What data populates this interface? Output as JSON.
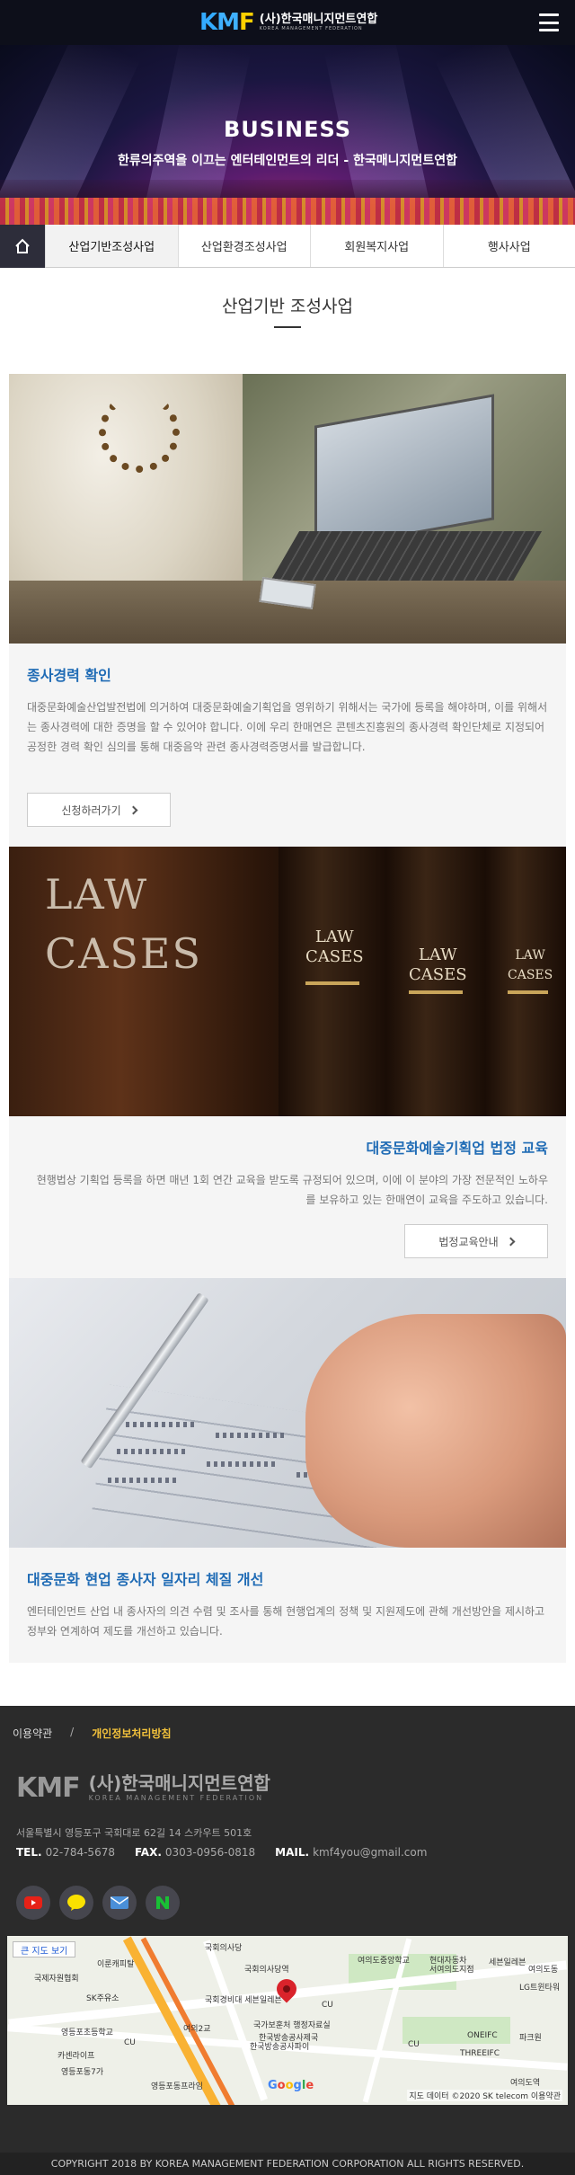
{
  "header": {
    "logo_mark": "KMF",
    "logo_ko": "(사)한국매니지먼트연합",
    "logo_en": "KOREA MANAGEMENT FEDERATION",
    "menu_icon": "hamburger-icon"
  },
  "hero": {
    "title": "BUSINESS",
    "subtitle": "한류의주역을 이끄는 엔터테인먼트의 리더 - 한국매니지먼트연합"
  },
  "tabs": {
    "home_icon": "home-icon",
    "items": [
      {
        "label": "산업기반조성사업",
        "active": true
      },
      {
        "label": "산업환경조성사업",
        "active": false
      },
      {
        "label": "회원복지사업",
        "active": false
      },
      {
        "label": "행사사업",
        "active": false
      }
    ]
  },
  "section": {
    "title": "산업기반 조성사업"
  },
  "cards": [
    {
      "title": "종사경력 확인",
      "desc": "대중문화예술산업발전법에 의거하여 대중문화예술기획업을 영위하기 위해서는 국가에 등록을 해야하며, 이를 위해서는 종사경력에 대한 증명을 할 수 있어야 합니다. 이에 우리 한매연은 콘텐츠진흥원의 종사경력 확인단체로 지정되어 공정한 경력 확인 심의를 통해 대중음악 관련 종사경력증명서를 발급합니다.",
      "button": "신청하러가기"
    },
    {
      "title": "대중문화예술기획업 법정 교육",
      "desc": "현행법상 기획업 등록을 하면 매년 1회 연간 교육을 받도록 규정되어 있으며, 이에 이 분야의 가장 전문적인 노하우를 보유하고 있는 한매연이 교육을 주도하고 있습니다.",
      "button": "법정교육안내"
    },
    {
      "title": "대중문화 현업 종사자 일자리 체질 개선",
      "desc": "엔터테인먼트 산업 내 종사자의 의견 수렴 및 조사를 통해 현행업계의 정책 및 지원제도에 관해 개선방안을 제시하고 정부와 연계하여 제도를 개선하고 있습니다."
    }
  ],
  "images": {
    "law_big": "LAW\nCASES",
    "law_small": "LAW\nCASES"
  },
  "footer": {
    "terms": "이용약관",
    "sep": "/",
    "privacy": "개인정보처리방침",
    "logo_mark": "KMF",
    "logo_ko": "(사)한국매니지먼트연합",
    "logo_en": "KOREA MANAGEMENT FEDERATION",
    "address": "서울특별시 영등포구 국회대로 62길 14 스카우트 501호",
    "tel_label": "TEL.",
    "tel": "02-784-5678",
    "fax_label": "FAX.",
    "fax": "0303-0956-0818",
    "mail_label": "MAIL.",
    "mail": "kmf4you@gmail.com",
    "socials": [
      "youtube-icon",
      "kakaotalk-icon",
      "mail-icon",
      "naver-icon"
    ]
  },
  "map": {
    "big_view": "큰 지도 보기",
    "labels": [
      "국회의사당역",
      "여의도중앙학교",
      "현대자동차",
      "서여의도지점",
      "세븐일레븐",
      "여의도동",
      "이룬캐피탈",
      "SK주유소",
      "국회경비대 세븐일레븐",
      "CU",
      "여의2교",
      "LG트윈타워",
      "영등포초등학교",
      "CU",
      "국가보훈처 행정자료실",
      "한국방송공사파이",
      "한국방송공사제국",
      "카센라이프",
      "영등포동7가",
      "CU",
      "ONEIFC",
      "THREEIFC",
      "파크원",
      "국회의사당",
      "여의도역",
      "영등포동프라임",
      "국제자원협회"
    ],
    "google": "Google",
    "credit": "지도 데이터 ©2020 SK telecom   이용약관"
  },
  "copyright": "COPYRIGHT 2018 BY KOREA MANAGEMENT FEDERATION CORPORATION ALL RIGHTS RESERVED."
}
